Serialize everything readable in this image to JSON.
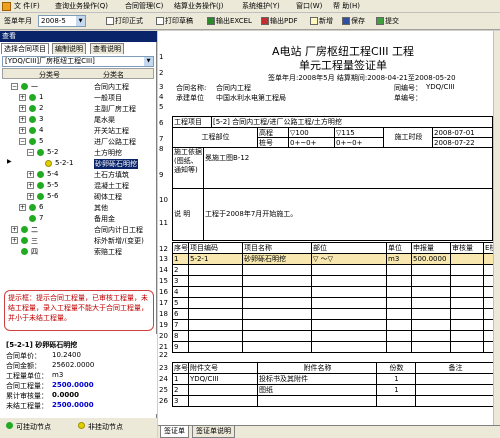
{
  "menu": [
    "文 件(F)",
    "查询业务操作(Q)",
    "合同管理(C)",
    "结算业务操作(J)",
    "系统维护(Y)",
    "窗口(W)",
    "帮 助(H)"
  ],
  "toolbar": {
    "period_label": "签单年月",
    "period_value": "2008-5",
    "print_formal": "打印正式",
    "print_draft": "打印草稿",
    "export_excel": "输出EXCEL",
    "export_pdf": "输出PDF",
    "add": "新增",
    "save": "保存",
    "submit": "提交"
  },
  "left_panel": {
    "title": "查看",
    "tabs": [
      "选择合同项目",
      "编制说明",
      "查看说明"
    ],
    "project_select": "[YDQ/CIII]厂房枢纽工程CIII]",
    "tree_headers": [
      "分类号",
      "分类名"
    ],
    "tree": [
      {
        "code": "一",
        "name": "合同内工程"
      },
      {
        "code": "1",
        "name": "一般项目"
      },
      {
        "code": "2",
        "name": "主副厂房工程"
      },
      {
        "code": "3",
        "name": "尾水渠"
      },
      {
        "code": "4",
        "name": "开关站工程"
      },
      {
        "code": "5",
        "name": "进厂公路工程"
      },
      {
        "code": "5-2",
        "name": "土方明挖"
      },
      {
        "code": "5-2-1",
        "name": "砂卵砾石明挖"
      },
      {
        "code": "5-4",
        "name": "土石方填筑"
      },
      {
        "code": "5-5",
        "name": "混凝土工程"
      },
      {
        "code": "5-6",
        "name": "砌体工程"
      },
      {
        "code": "6",
        "name": "其他"
      },
      {
        "code": "7",
        "name": "备用金"
      },
      {
        "code": "二",
        "name": "合同内计日工程"
      },
      {
        "code": "三",
        "name": "标外新增/(变更)"
      },
      {
        "code": "四",
        "name": "索赔工程"
      }
    ],
    "hint": "提示框：提示合同工程量，已审核工程量，未结工程量，录入工程量不能大于合同工程量，并小于未结工程量。",
    "info": {
      "item": "[5-2-1] 砂卵砾石明挖",
      "contract_price_label": "合同单价：",
      "contract_price": "10.2400",
      "contract_amount_label": "合同金额：",
      "contract_amount": "25602.0000",
      "unit_label": "工程量单位：",
      "unit": "m3",
      "contract_qty_label": "合同工程量：",
      "contract_qty": "2500.0000",
      "audited_label": "累计审核量：",
      "audited": "0.0000",
      "unsettled_label": "未结工程量：",
      "unsettled": "2500.0000"
    },
    "legend": [
      "可挂动节点",
      "非挂动节点"
    ]
  },
  "document": {
    "title": "A电站 厂房枢纽工程CIII 工程",
    "subtitle": "单元工程量签证单",
    "sign_line": "签单年月:2008年5月  结算期间:2008-04-21至2008-05-20",
    "contract_name_label": "合同名称:",
    "contract_name": "合同内工程",
    "contract_no_label": "同编号：",
    "contract_no": "YDQ/CIII",
    "builder_label": "承建单位",
    "builder": "中国水利水电第工程局",
    "doc_no_label": "单编号：",
    "project_label": "工程项目",
    "project": "[5-2] 合同内工程/进厂公路工程/土方明挖",
    "part_label": "工程部位",
    "elev_label": "高程",
    "elev_from": "▽100",
    "elev_to": "▽115",
    "station_label": "桩号",
    "station_from": "0+~0+",
    "station_to": "0+~0+",
    "period_label": "施工时段",
    "period_from": "2008-07-01",
    "period_to": "2008-07-22",
    "basis_label": "施工依据(图纸、通知等)",
    "basis": "冕施工图B-12",
    "remark_label": "说  明",
    "remark": "工程于2008年7月开始施工。",
    "row_nums": [
      "1",
      "2",
      "3",
      "4",
      "5",
      "6",
      "7",
      "8",
      "9",
      "10",
      "11"
    ],
    "qty_headers": [
      "序号",
      "项目编码",
      "项目名称",
      "部位",
      "单位",
      "申报量",
      "审核量",
      "E核不"
    ],
    "qty_rows": [
      {
        "row": "13",
        "seq": "1",
        "code": "5-2-1",
        "name": "砂卵砾石明挖",
        "part": "▽ ～▽",
        "unit": "m3",
        "qty": "500.0000",
        "audit": ""
      },
      {
        "row": "14",
        "seq": "2",
        "code": "",
        "name": "",
        "part": "",
        "unit": "",
        "qty": "",
        "audit": ""
      },
      {
        "row": "15",
        "seq": "3",
        "code": "",
        "name": "",
        "part": "",
        "unit": "",
        "qty": "",
        "audit": ""
      },
      {
        "row": "16",
        "seq": "4",
        "code": "",
        "name": "",
        "part": "",
        "unit": "",
        "qty": "",
        "audit": ""
      },
      {
        "row": "17",
        "seq": "5",
        "code": "",
        "name": "",
        "part": "",
        "unit": "",
        "qty": "",
        "audit": ""
      },
      {
        "row": "18",
        "seq": "6",
        "code": "",
        "name": "",
        "part": "",
        "unit": "",
        "qty": "",
        "audit": ""
      },
      {
        "row": "19",
        "seq": "7",
        "code": "",
        "name": "",
        "part": "",
        "unit": "",
        "qty": "",
        "audit": ""
      },
      {
        "row": "20",
        "seq": "8",
        "code": "",
        "name": "",
        "part": "",
        "unit": "",
        "qty": "",
        "audit": ""
      },
      {
        "row": "21",
        "seq": "9",
        "code": "",
        "name": "",
        "part": "",
        "unit": "",
        "qty": "",
        "audit": ""
      }
    ],
    "att_headers": [
      "序号",
      "附件文号",
      "附件名称",
      "份数",
      "备注"
    ],
    "att_rows": [
      {
        "row": "24",
        "seq": "1",
        "no": "YDQ/CIII",
        "name": "投标书及其附件",
        "count": "1"
      },
      {
        "row": "25",
        "seq": "2",
        "no": "",
        "name": "图纸",
        "count": "1"
      },
      {
        "row": "26",
        "seq": "3",
        "no": "",
        "name": "",
        "count": ""
      }
    ],
    "row12": "12",
    "row22": "22",
    "row23": "23"
  },
  "bottom_tabs": [
    "签证单",
    "签证单说明"
  ]
}
